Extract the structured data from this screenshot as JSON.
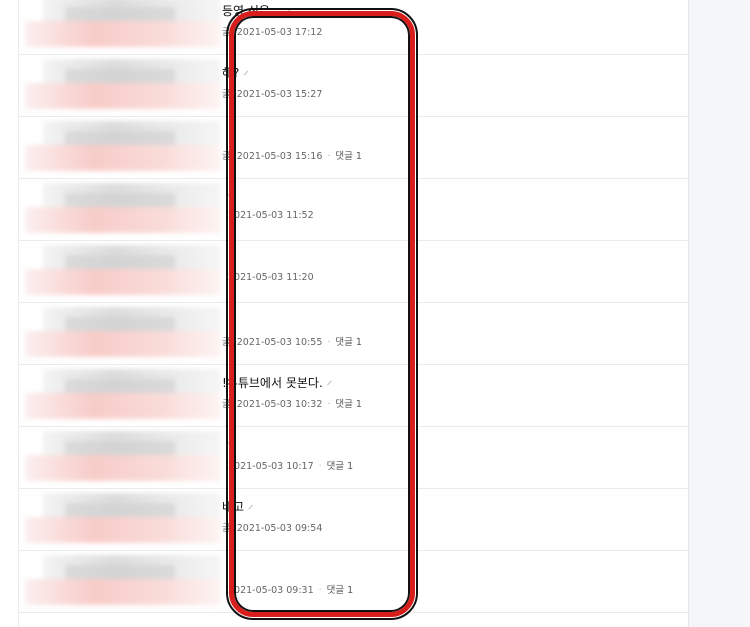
{
  "posts": [
    {
      "title": "등영 신은…",
      "has_attachment": true,
      "prefix": "글",
      "date": "2021-05-03 17:12",
      "comments": ""
    },
    {
      "title": "해?",
      "has_attachment": true,
      "prefix": "글",
      "date": "2021-05-03 15:27",
      "comments": ""
    },
    {
      "title": "",
      "has_attachment": false,
      "prefix": "글",
      "date": "2021-05-03 15:16",
      "comments": "댓글 1"
    },
    {
      "title": "",
      "has_attachment": true,
      "prefix": "",
      "date": "2021-05-03 11:52",
      "comments": ""
    },
    {
      "title": "",
      "has_attachment": false,
      "prefix": "",
      "date": "2021-05-03 11:20",
      "comments": ""
    },
    {
      "title": "",
      "has_attachment": false,
      "prefix": "글",
      "date": "2021-05-03 10:55",
      "comments": "댓글 1"
    },
    {
      "title": "!유튜브에서 못본다.",
      "has_attachment": true,
      "prefix": "글",
      "date": "2021-05-03 10:32",
      "comments": "댓글 1"
    },
    {
      "title": "",
      "has_attachment": true,
      "prefix": "",
      "date": "2021-05-03 10:17",
      "comments": "댓글 1"
    },
    {
      "title": "배고",
      "has_attachment": true,
      "prefix": "글",
      "date": "2021-05-03 09:54",
      "comments": ""
    },
    {
      "title": "",
      "has_attachment": false,
      "prefix": "",
      "date": "2021-05-03 09:31",
      "comments": "댓글 1"
    }
  ],
  "icons": {
    "attachment": "paperclip-icon"
  },
  "colors": {
    "highlight": "#d81d1d",
    "gutter": "#f5f6f8"
  }
}
